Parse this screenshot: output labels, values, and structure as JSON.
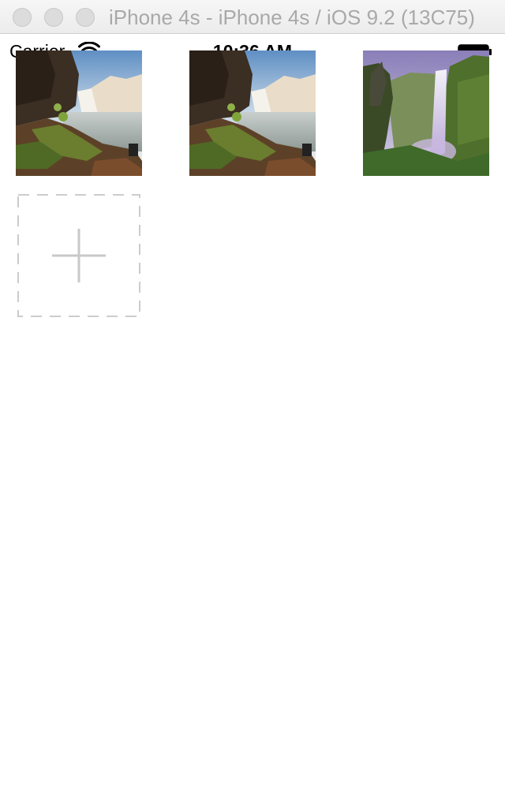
{
  "window": {
    "title": "iPhone 4s - iPhone 4s / iOS 9.2 (13C75)"
  },
  "status_bar": {
    "carrier": "Carrier",
    "time": "10:36 AM",
    "icons": [
      "wifi-icon",
      "battery-icon"
    ]
  },
  "photos": [
    {
      "name": "photo-waterfall-cliff-1",
      "scene": "waterfall-cliff"
    },
    {
      "name": "photo-waterfall-cliff-2",
      "scene": "waterfall-cliff"
    },
    {
      "name": "photo-waterfall-canyon",
      "scene": "waterfall-canyon"
    }
  ],
  "add_photo": {
    "icon": "plus-icon"
  },
  "colors": {
    "title_text": "#a9a9a9",
    "traffic_light": "#dcdcdc",
    "dashed_border": "#cccccc",
    "plus": "#c8c8c8"
  }
}
